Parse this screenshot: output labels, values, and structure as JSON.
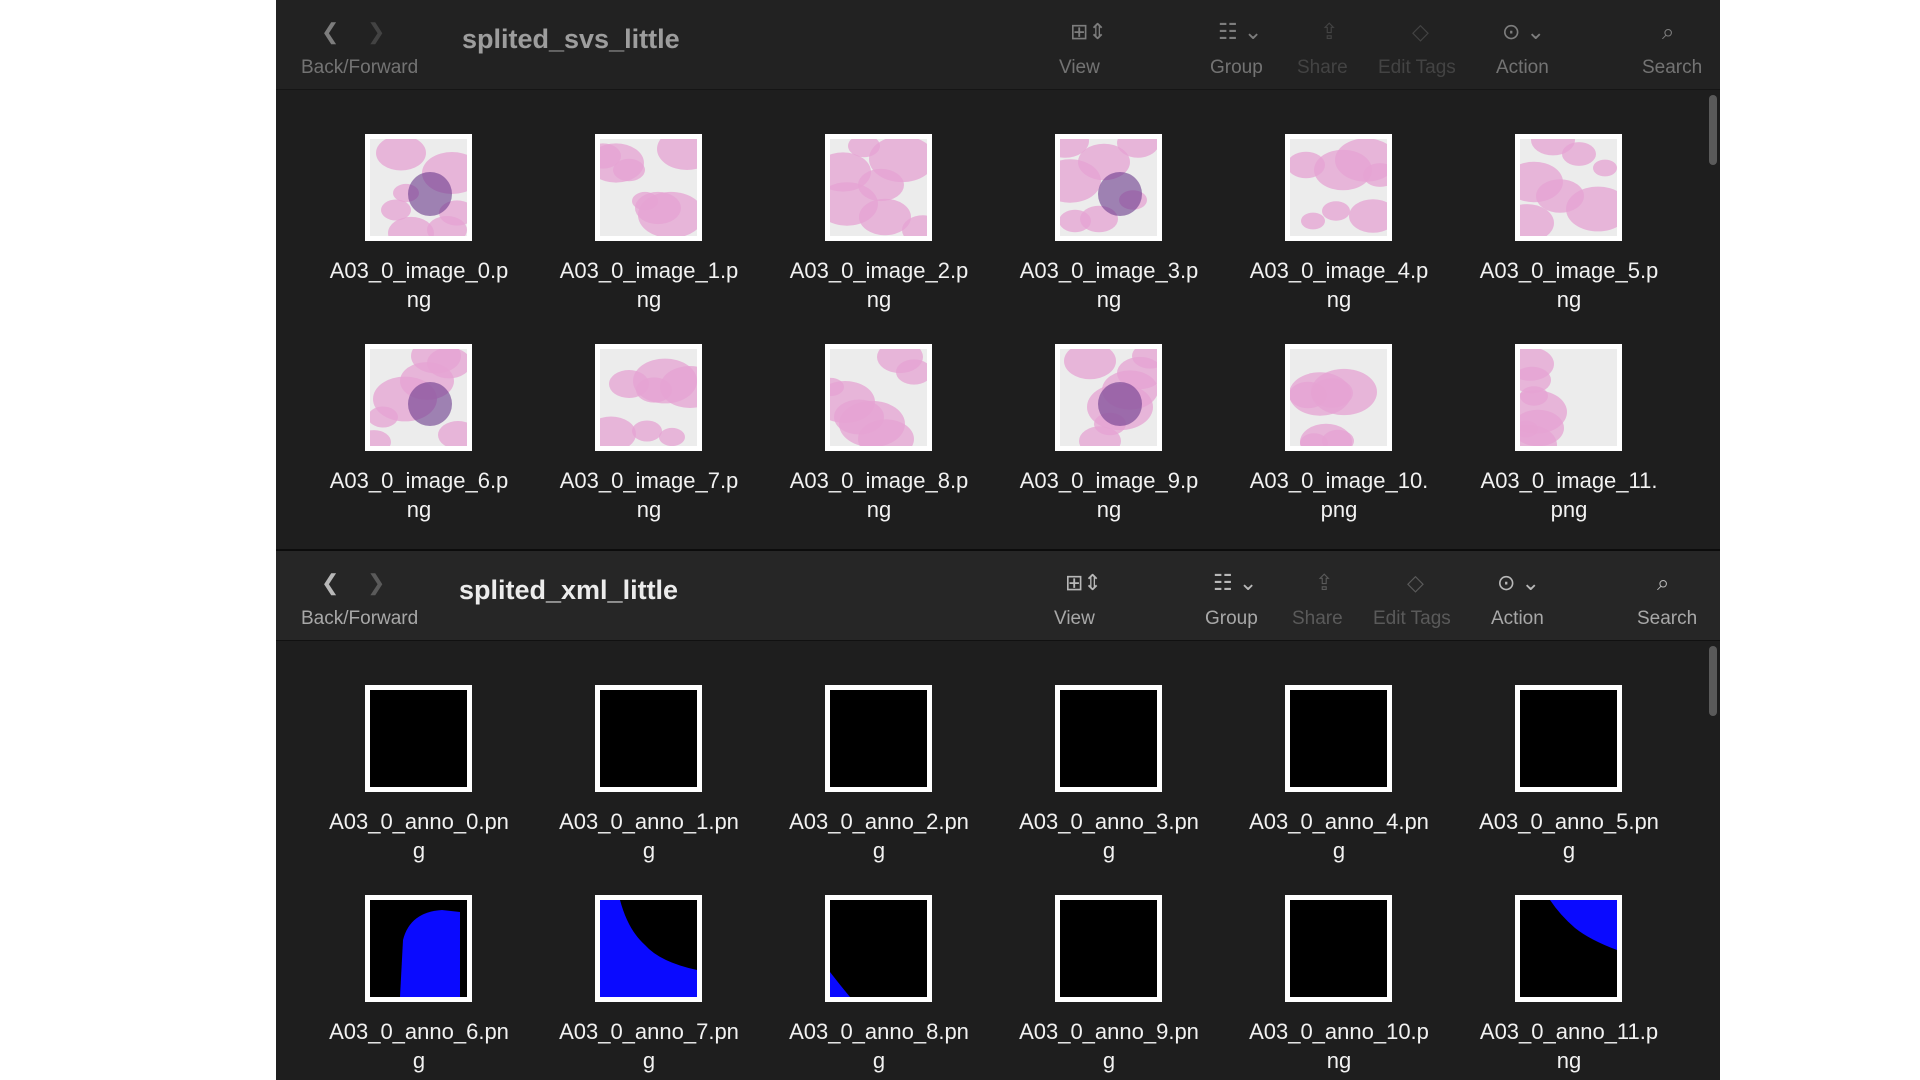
{
  "colors": {
    "window_bg": "#1e1e1e",
    "toolbar_bg": "#262626",
    "mask_fill": "#0a0aff",
    "tissue_pink": "#e6a3d3"
  },
  "windows": [
    {
      "title": "splited_svs_little",
      "toolbar": {
        "nav_label": "Back/Forward",
        "view_label": "View",
        "group_label": "Group",
        "share_label": "Share",
        "tags_label": "Edit Tags",
        "action_label": "Action",
        "search_label": "Search"
      },
      "files": [
        {
          "name": "A03_0_image_0.p\nng",
          "thumb": "tissue"
        },
        {
          "name": "A03_0_image_1.p\nng",
          "thumb": "tissue"
        },
        {
          "name": "A03_0_image_2.p\nng",
          "thumb": "tissue"
        },
        {
          "name": "A03_0_image_3.p\nng",
          "thumb": "tissue"
        },
        {
          "name": "A03_0_image_4.p\nng",
          "thumb": "tissue"
        },
        {
          "name": "A03_0_image_5.p\nng",
          "thumb": "tissue"
        },
        {
          "name": "A03_0_image_6.p\nng",
          "thumb": "tissue"
        },
        {
          "name": "A03_0_image_7.p\nng",
          "thumb": "tissue"
        },
        {
          "name": "A03_0_image_8.p\nng",
          "thumb": "tissue"
        },
        {
          "name": "A03_0_image_9.p\nng",
          "thumb": "tissue"
        },
        {
          "name": "A03_0_image_10.\npng",
          "thumb": "tissue"
        },
        {
          "name": "A03_0_image_11.\npng",
          "thumb": "tissue"
        }
      ]
    },
    {
      "title": "splited_xml_little",
      "toolbar": {
        "nav_label": "Back/Forward",
        "view_label": "View",
        "group_label": "Group",
        "share_label": "Share",
        "tags_label": "Edit Tags",
        "action_label": "Action",
        "search_label": "Search"
      },
      "files": [
        {
          "name": "A03_0_anno_0.pn\ng",
          "thumb": "mask-empty"
        },
        {
          "name": "A03_0_anno_1.pn\ng",
          "thumb": "mask-empty"
        },
        {
          "name": "A03_0_anno_2.pn\ng",
          "thumb": "mask-empty"
        },
        {
          "name": "A03_0_anno_3.pn\ng",
          "thumb": "mask-empty"
        },
        {
          "name": "A03_0_anno_4.pn\ng",
          "thumb": "mask-empty"
        },
        {
          "name": "A03_0_anno_5.pn\ng",
          "thumb": "mask-empty"
        },
        {
          "name": "A03_0_anno_6.pn\ng",
          "thumb": "mask-blob-center"
        },
        {
          "name": "A03_0_anno_7.pn\ng",
          "thumb": "mask-blob-bottom-left"
        },
        {
          "name": "A03_0_anno_8.pn\ng",
          "thumb": "mask-corner-bottom-left"
        },
        {
          "name": "A03_0_anno_9.pn\ng",
          "thumb": "mask-empty"
        },
        {
          "name": "A03_0_anno_10.p\nng",
          "thumb": "mask-empty"
        },
        {
          "name": "A03_0_anno_11.p\nng",
          "thumb": "mask-corner-top-right"
        }
      ]
    }
  ]
}
